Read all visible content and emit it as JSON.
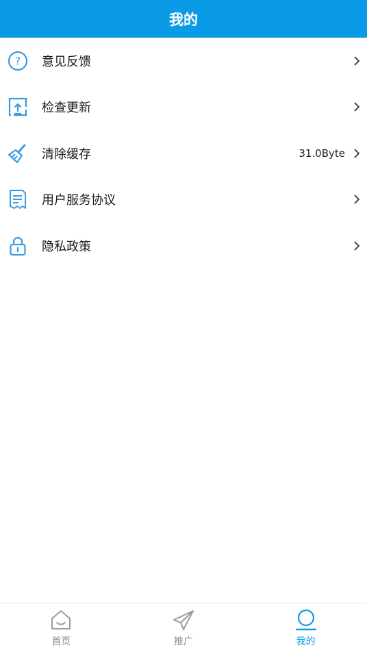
{
  "header": {
    "title": "我的"
  },
  "menu": {
    "items": [
      {
        "label": "意见反馈",
        "icon": "feedback-question-icon"
      },
      {
        "label": "检查更新",
        "icon": "upload-update-icon"
      },
      {
        "label": "清除缓存",
        "icon": "broom-icon",
        "value": "31.0Byte"
      },
      {
        "label": "用户服务协议",
        "icon": "document-icon"
      },
      {
        "label": "隐私政策",
        "icon": "lock-icon"
      }
    ]
  },
  "tabbar": {
    "tabs": [
      {
        "label": "首页",
        "icon": "home-icon",
        "active": false
      },
      {
        "label": "推广",
        "icon": "paper-plane-icon",
        "active": false
      },
      {
        "label": "我的",
        "icon": "user-icon",
        "active": true
      }
    ]
  },
  "colors": {
    "accent": "#0b9be6",
    "icon_blue": "#3a9be0",
    "inactive": "#8a8a8a"
  }
}
